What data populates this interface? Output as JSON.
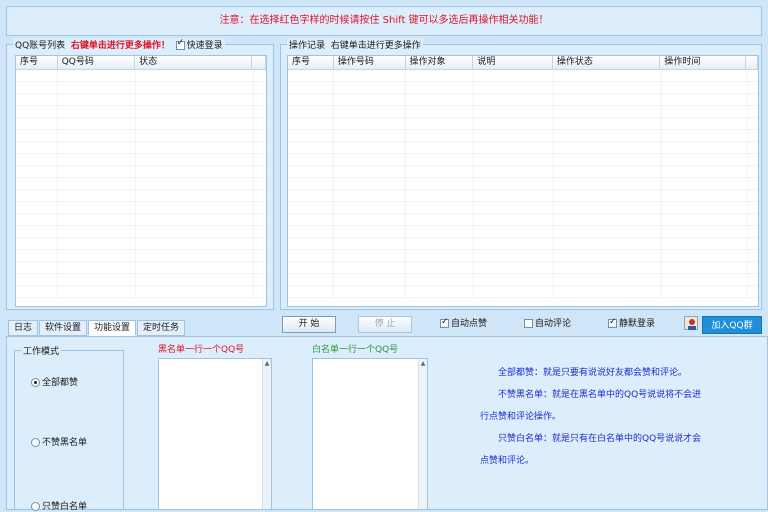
{
  "notice": "注意：在选择红色字样的时候请按住 Shift 键可以多选后再操作相关功能！",
  "left_panel": {
    "title": "QQ账号列表",
    "hint": "右键单击进行更多操作！",
    "quick_login": {
      "label": "快速登录",
      "checked": true
    },
    "columns": [
      "序号",
      "QQ号码",
      "状态"
    ]
  },
  "right_panel": {
    "title": "操作记录",
    "hint": "右键单击进行更多操作",
    "columns": [
      "序号",
      "操作号码",
      "操作对象",
      "说明",
      "操作状态",
      "操作时间"
    ]
  },
  "tabs": [
    "日志",
    "软件设置",
    "功能设置",
    "定时任务"
  ],
  "active_tab": 2,
  "controls": {
    "start_label": "开 始",
    "stop_label": "停 止",
    "auto_like": {
      "label": "自动点赞",
      "checked": true
    },
    "auto_comment": {
      "label": "自动评论",
      "checked": false
    },
    "silent": {
      "label": "静默登录",
      "checked": true
    },
    "qq_group_button": "加入QQ群",
    "person_icon": "person-icon"
  },
  "work_mode": {
    "title": "工作模式",
    "options": [
      "全部都赞",
      "不赞黑名单",
      "只赞白名单"
    ],
    "selected": 0
  },
  "blacklist": {
    "label": "黑名单一行一个QQ号"
  },
  "whitelist": {
    "label": "白名单一行一个QQ号"
  },
  "description": [
    "全部都赞：就是只要有说说好友都会赞和评论。",
    "不赞黑名单：就是在黑名单中的QQ号说说将不会进行点赞和评论操作。",
    "只赞白名单：就是只有在白名单中的QQ号说说才会点赞和评论。"
  ],
  "colors": {
    "background": "#cfe6f8",
    "warning_red": "#e0142a",
    "link_blue": "#1b2fd0",
    "qq_button": "#1e8fd8",
    "whitelist_green": "#2a9a3a"
  }
}
